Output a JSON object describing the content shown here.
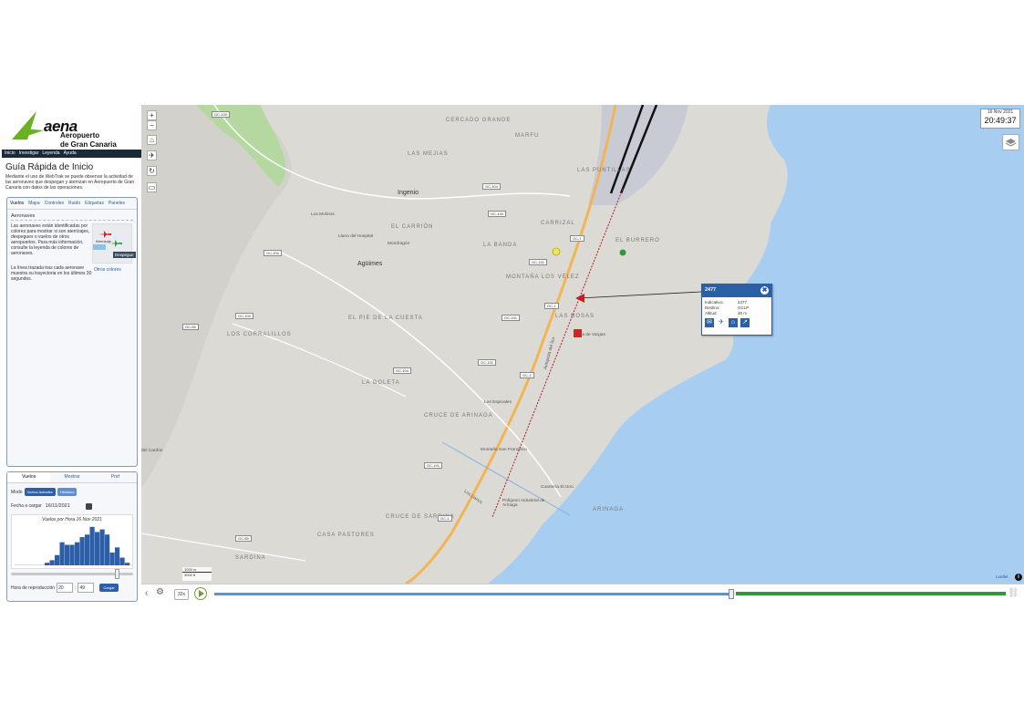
{
  "brand": {
    "word": "aena",
    "line1": "Aeropuerto",
    "line2": "de Gran Canaria",
    "color": "#6ab023"
  },
  "topnav": [
    "Inicio",
    "Investigar",
    "Leyenda",
    "Ayuda"
  ],
  "guide": {
    "title": "Guía Rápida de Inicio",
    "text": "Mediante el uso de WebTrak se puede observar la actividad de las aeronaves que despegan y aterrizan en Aeropuerto de Gran Canaria con datos de las operaciones."
  },
  "panel1": {
    "tabs": [
      "Vuelos",
      "Mapa",
      "Controles",
      "Ruido",
      "Etiquetas",
      "Paneles"
    ],
    "section_title": "Aeronaves",
    "aircraft_text": "Las aeronaves están identificadas por colores para mostrar si son aterrizajes, despegues o vuelos de otros aeropuertos. Para más información, consulte la leyenda de colores de aeronaves.",
    "image_caption": "Aterrizaje",
    "image_badge": "Despegue",
    "line_text": "La línea trazada tras cada aeronave muestra su trayectoria en los últimos 30 segundos.",
    "other_colors": "Otros colores"
  },
  "panel2": {
    "tabs": [
      "Vuelos",
      "Mostrar",
      "Pref"
    ],
    "modo_label": "Modo",
    "mode_live": "Vuelos Actuales",
    "mode_history": "Histórico",
    "fecha_label": "Fecha a cargar",
    "fecha_value": "16/11/2021",
    "hist_title": "Vuelos por Hora 16 Nov 2021",
    "hora_label": "Hora de reproducción",
    "hora_h": "20",
    "hora_m": "49",
    "cargar": "Cargar",
    "hourly_counts": [
      0,
      0,
      0,
      0,
      0,
      0,
      1,
      2,
      4,
      9,
      8,
      8,
      9,
      11,
      12,
      15,
      13,
      14,
      12,
      5,
      7,
      3,
      1,
      0
    ]
  },
  "map": {
    "date": "16 Nov 2021",
    "time": "20:49:37",
    "popup": {
      "title": "2477",
      "rows": [
        {
          "k": "Indicativo:",
          "v": "2477"
        },
        {
          "k": "Destino:",
          "v": "GCLP"
        },
        {
          "k": "Altitud:",
          "v": "30 m"
        }
      ]
    },
    "scale_m": "1000 m",
    "scale_ft": "3000 ft",
    "attribution": "Leaflet",
    "places": [
      {
        "t": "CERCADO GRANDE",
        "c": "place"
      },
      {
        "t": "MARFU",
        "c": "place"
      },
      {
        "t": "LAS MEJIAS",
        "c": "place"
      },
      {
        "t": "LAS PUNTILLAS",
        "c": "place"
      },
      {
        "t": "EL CARRIÓN",
        "c": "place"
      },
      {
        "t": "CARRIZAL",
        "c": "place"
      },
      {
        "t": "LA BANDA",
        "c": "place"
      },
      {
        "t": "EL BURRERO",
        "c": "place"
      },
      {
        "t": "MONTAÑA LOS VÉLEZ",
        "c": "place"
      },
      {
        "t": "LAS ROSAS",
        "c": "place"
      },
      {
        "t": "LOS CORRALILLOS",
        "c": "place"
      },
      {
        "t": "EL PIE DE LA CUESTA",
        "c": "place"
      },
      {
        "t": "LA GOLETA",
        "c": "place"
      },
      {
        "t": "CRUCE DE ARINAGA",
        "c": "place"
      },
      {
        "t": "CRUCE DE SARDINA",
        "c": "place"
      },
      {
        "t": "CASA PASTORES",
        "c": "place"
      },
      {
        "t": "SARDINA",
        "c": "place"
      },
      {
        "t": "ARINAGA",
        "c": "place"
      }
    ],
    "towns": [
      "Ingenio",
      "Agüimes"
    ],
    "small_places": [
      "Los Molinos",
      "Llano del Hospital",
      "Mondragón",
      "Los Espinales",
      "Montaña San Francisco",
      "Cuartería El Uno",
      "Polígono Industrial de Arinaga",
      "Playa de Vargas",
      "del Cardón",
      "Autopista del Sur",
      "Los Llanos"
    ],
    "roads": [
      "GC-100",
      "GC-104",
      "GC-140",
      "GC-100",
      "GC-1",
      "GC-191",
      "GC-1",
      "GC-65",
      "GC-100",
      "GC-191",
      "GC-104",
      "GC-1",
      "GC-191",
      "GC-191",
      "GC-1",
      "GC-65"
    ]
  }
}
